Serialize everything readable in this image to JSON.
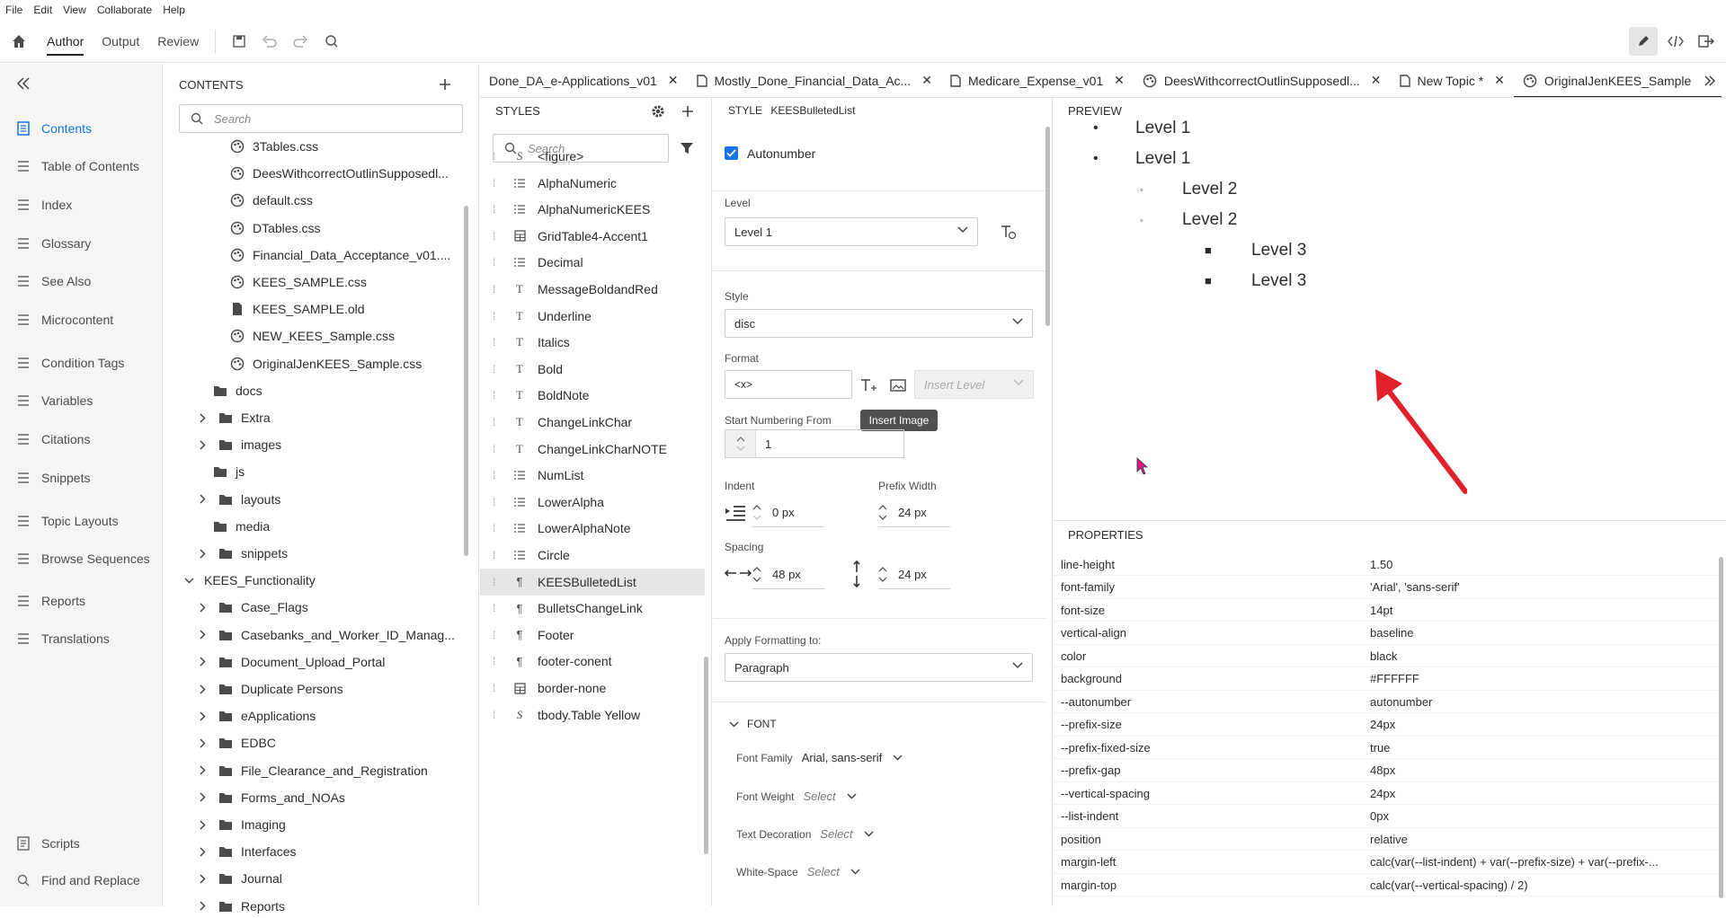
{
  "menu": [
    "File",
    "Edit",
    "View",
    "Collaborate",
    "Help"
  ],
  "toolbar": {
    "tabs": [
      "Author",
      "Output",
      "Review"
    ],
    "active": "Author"
  },
  "leftnav": {
    "items": [
      "Contents",
      "Table of Contents",
      "Index",
      "Glossary",
      "See Also",
      "Microcontent",
      "Condition Tags",
      "Variables",
      "Citations",
      "Snippets",
      "Topic Layouts",
      "Browse Sequences",
      "Reports",
      "Translations"
    ],
    "bottom": [
      "Scripts",
      "Find and Replace"
    ],
    "active": "Contents"
  },
  "contents": {
    "title": "CONTENTS",
    "search_placeholder": "Search",
    "tree": [
      {
        "label": "3Tables.css",
        "icon": "css-icon"
      },
      {
        "label": "DeesWithcorrectOutlinSupposedl...",
        "icon": "css-icon"
      },
      {
        "label": "default.css",
        "icon": "css-icon"
      },
      {
        "label": "DTables.css",
        "icon": "css-icon"
      },
      {
        "label": "Financial_Data_Acceptance_v01....",
        "icon": "css-icon"
      },
      {
        "label": "KEES_SAMPLE.css",
        "icon": "css-icon"
      },
      {
        "label": "KEES_SAMPLE.old",
        "icon": "file-icon"
      },
      {
        "label": "NEW_KEES_Sample.css",
        "icon": "css-icon"
      },
      {
        "label": "OriginalJenKEES_Sample.css",
        "icon": "css-icon"
      },
      {
        "label": "docs",
        "icon": "folder-icon"
      },
      {
        "label": "Extra",
        "icon": "folder-icon",
        "chev": "right"
      },
      {
        "label": "images",
        "icon": "folder-icon",
        "chev": "right"
      },
      {
        "label": "js",
        "icon": "folder-icon"
      },
      {
        "label": "layouts",
        "icon": "folder-icon",
        "chev": "right"
      },
      {
        "label": "media",
        "icon": "folder-icon"
      },
      {
        "label": "snippets",
        "icon": "folder-icon",
        "chev": "right"
      },
      {
        "label": "KEES_Functionality",
        "icon": "none",
        "chev": "down"
      },
      {
        "label": "Case_Flags",
        "icon": "folder-icon",
        "chev": "right"
      },
      {
        "label": "Casebanks_and_Worker_ID_Manag...",
        "icon": "folder-icon",
        "chev": "right"
      },
      {
        "label": "Document_Upload_Portal",
        "icon": "folder-icon",
        "chev": "right"
      },
      {
        "label": "Duplicate Persons",
        "icon": "folder-icon",
        "chev": "right"
      },
      {
        "label": "eApplications",
        "icon": "folder-icon",
        "chev": "right"
      },
      {
        "label": "EDBC",
        "icon": "folder-icon",
        "chev": "right"
      },
      {
        "label": "File_Clearance_and_Registration",
        "icon": "folder-icon",
        "chev": "right"
      },
      {
        "label": "Forms_and_NOAs",
        "icon": "folder-icon",
        "chev": "right"
      },
      {
        "label": "Imaging",
        "icon": "folder-icon",
        "chev": "right"
      },
      {
        "label": "Interfaces",
        "icon": "folder-icon",
        "chev": "right"
      },
      {
        "label": "Journal",
        "icon": "folder-icon",
        "chev": "right"
      },
      {
        "label": "Reports",
        "icon": "folder-icon",
        "chev": "right"
      }
    ]
  },
  "doctabs": [
    {
      "label": "Done_DA_e-Applications_v01"
    },
    {
      "label": "Mostly_Done_Financial_Data_Ac..."
    },
    {
      "label": "Medicare_Expense_v01"
    },
    {
      "label": "DeesWithcorrectOutlinSupposedl..."
    },
    {
      "label": "New Topic *"
    },
    {
      "label": "OriginalJenKEES_Sample",
      "active": true
    }
  ],
  "styles": {
    "title": "STYLES",
    "search_placeholder": "Search",
    "items": [
      {
        "label": "<figure>",
        "icon": "S"
      },
      {
        "label": "AlphaNumeric",
        "icon": "list"
      },
      {
        "label": "AlphaNumericKEES",
        "icon": "list"
      },
      {
        "label": "GridTable4-Accent1",
        "icon": "table"
      },
      {
        "label": "Decimal",
        "icon": "list"
      },
      {
        "label": "MessageBoldandRed",
        "icon": "T"
      },
      {
        "label": "Underline",
        "icon": "T"
      },
      {
        "label": "Italics",
        "icon": "T"
      },
      {
        "label": "Bold",
        "icon": "T"
      },
      {
        "label": "BoldNote",
        "icon": "T"
      },
      {
        "label": "ChangeLinkChar",
        "icon": "T"
      },
      {
        "label": "ChangeLinkCharNOTE",
        "icon": "T"
      },
      {
        "label": "NumList",
        "icon": "list"
      },
      {
        "label": "LowerAlpha",
        "icon": "list"
      },
      {
        "label": "LowerAlphaNote",
        "icon": "list"
      },
      {
        "label": "Circle",
        "icon": "list"
      },
      {
        "label": "KEESBulletedList",
        "icon": "para",
        "selected": true
      },
      {
        "label": "BulletsChangeLink",
        "icon": "para"
      },
      {
        "label": "Footer",
        "icon": "para"
      },
      {
        "label": "footer-conent",
        "icon": "para"
      },
      {
        "label": "border-none",
        "icon": "table"
      },
      {
        "label": "tbody.Table Yellow",
        "icon": "S"
      }
    ]
  },
  "editor": {
    "style_label": "STYLE",
    "style_name": "KEESBulletedList",
    "autonumber_label": "Autonumber",
    "level_label": "Level",
    "level_value": "Level 1",
    "style_field_label": "Style",
    "style_value": "disc",
    "format_label": "Format",
    "format_value": "<x>",
    "insert_level": "Insert Level",
    "tooltip": "Insert Image",
    "start_label": "Start Numbering From",
    "start_value": "1",
    "indent_label": "Indent",
    "indent_value": "0 px",
    "prefix_label": "Prefix Width",
    "prefix_value": "24 px",
    "spacing_label": "Spacing",
    "spacing_h": "48 px",
    "spacing_v": "24 px",
    "apply_label": "Apply Formatting to:",
    "apply_value": "Paragraph",
    "font_section": "FONT",
    "font_family_label": "Font Family",
    "font_family_value": "Arial, sans-serif",
    "font_weight_label": "Font Weight",
    "text_decoration_label": "Text Decoration",
    "white_space_label": "White-Space",
    "select": "Select"
  },
  "preview": {
    "title": "PREVIEW",
    "items": [
      {
        "bullet": "•",
        "text": "Level 1",
        "level": 1
      },
      {
        "bullet": "•",
        "text": "Level 1",
        "level": 1
      },
      {
        "bullet": "◦",
        "text": "Level 2",
        "level": 2
      },
      {
        "bullet": "◦",
        "text": "Level 2",
        "level": 2
      },
      {
        "bullet": "■",
        "text": "Level 3",
        "level": 3
      },
      {
        "bullet": "■",
        "text": "Level 3",
        "level": 3
      }
    ],
    "arrow_color": "#e0202a"
  },
  "properties": {
    "title": "PROPERTIES",
    "rows": [
      [
        "line-height",
        "1.50"
      ],
      [
        "font-family",
        "'Arial', 'sans-serif'"
      ],
      [
        "font-size",
        "14pt"
      ],
      [
        "vertical-align",
        "baseline"
      ],
      [
        "color",
        "black"
      ],
      [
        "background",
        "#FFFFFF"
      ],
      [
        "--autonumber",
        "autonumber"
      ],
      [
        "--prefix-size",
        "24px"
      ],
      [
        "--prefix-fixed-size",
        "true"
      ],
      [
        "--prefix-gap",
        "48px"
      ],
      [
        "--vertical-spacing",
        "24px"
      ],
      [
        "--list-indent",
        "0px"
      ],
      [
        "position",
        "relative"
      ],
      [
        "margin-left",
        "calc(var(--list-indent) + var(--prefix-size) + var(--prefix-..."
      ],
      [
        "margin-top",
        "calc(var(--vertical-spacing) / 2)"
      ]
    ]
  },
  "colors": {
    "accent": "#1473e6",
    "selected_bg": "#e6e6e6"
  }
}
